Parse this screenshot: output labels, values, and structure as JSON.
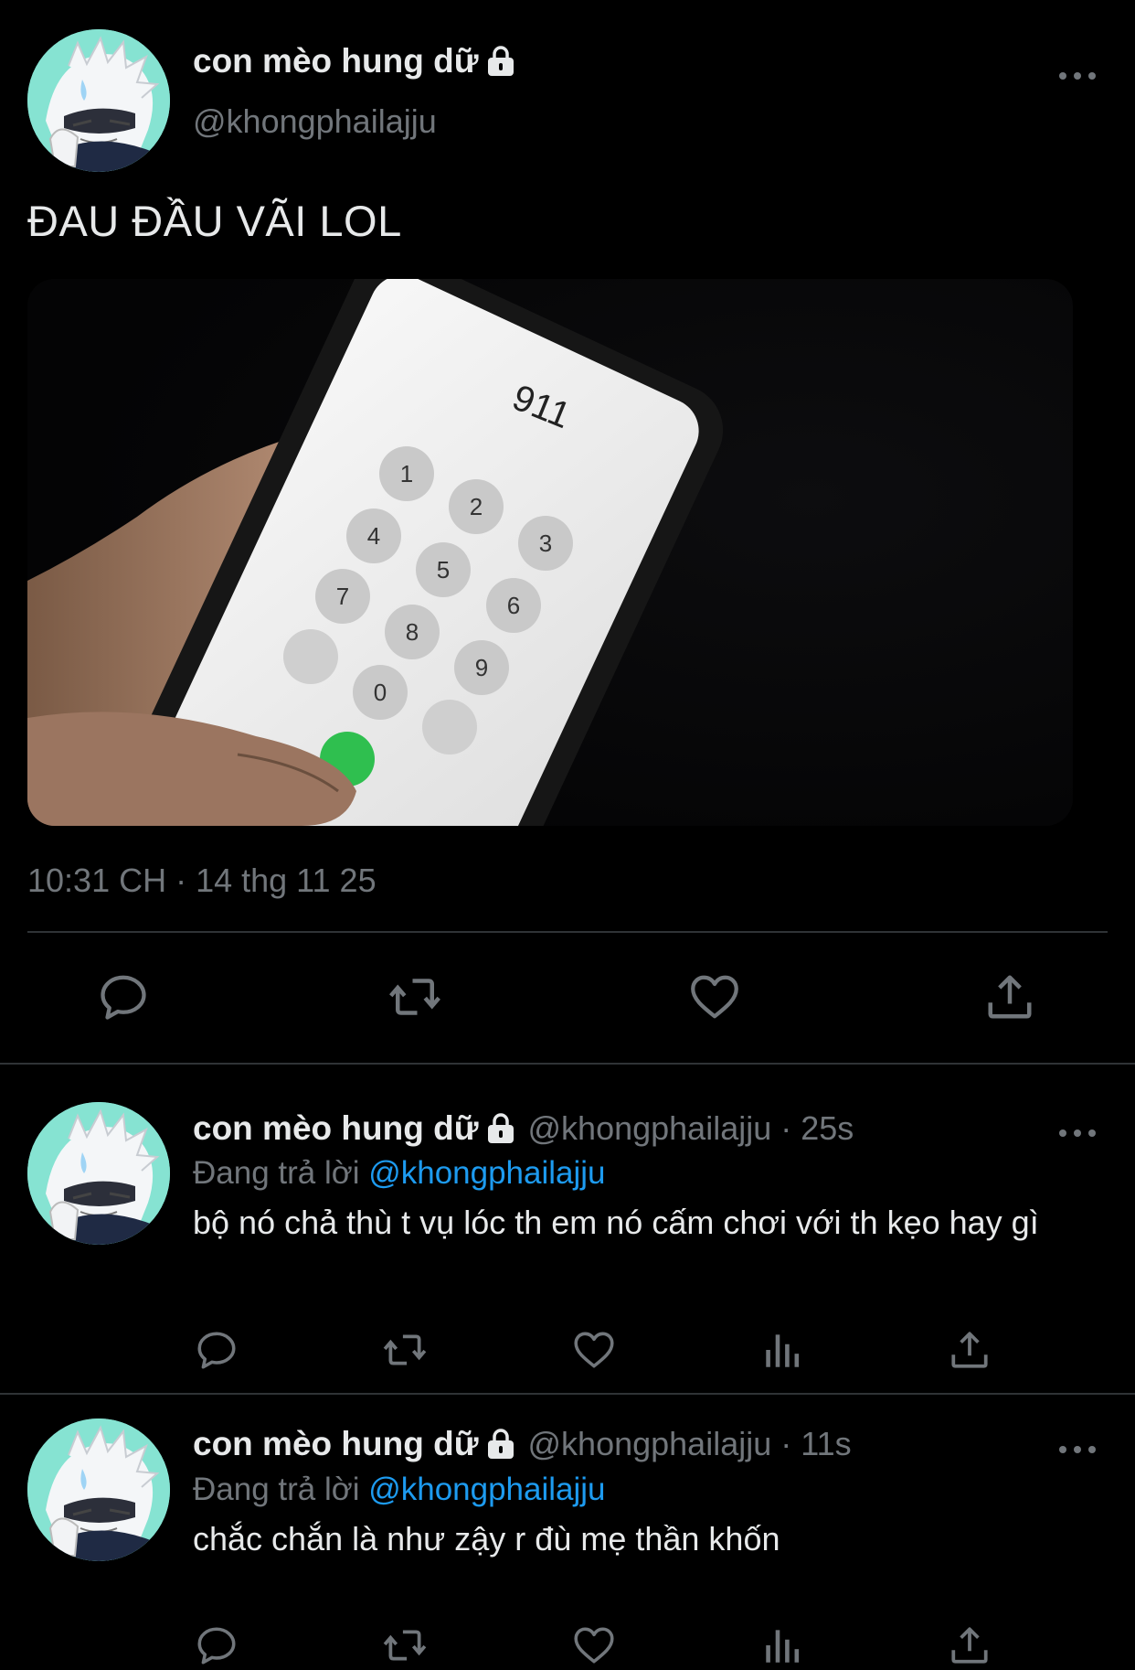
{
  "main_tweet": {
    "display_name": "con mèo hung dữ",
    "handle": "@khongphailajju",
    "text": "ĐAU ĐẦU VÃI LOL",
    "timestamp": "10:31 CH · 14 thg 11 25",
    "media": {
      "dialed_number": "911",
      "keypad": [
        "1",
        "2",
        "3",
        "4",
        "5",
        "6",
        "7",
        "8",
        "9",
        "0"
      ]
    }
  },
  "replies": [
    {
      "display_name": "con mèo hung dữ",
      "handle_time": "@khongphailajju · 25s",
      "replying_label": "Đang trả lời",
      "replying_to": "@khongphailajju",
      "text": "bộ nó chả thù t vụ lóc th em nó cấm chơi với th kẹo hay gì"
    },
    {
      "display_name": "con mèo hung dữ",
      "handle_time": "@khongphailajju · 11s",
      "replying_label": "Đang trả lời",
      "replying_to": "@khongphailajju",
      "text": "chắc chắn là như zậy r đù mẹ thần khốn"
    }
  ],
  "icons": {
    "reply": "speech-bubble-icon",
    "retweet": "retweet-icon",
    "like": "heart-icon",
    "views": "bar-chart-icon",
    "share": "share-icon",
    "more": "more-dots-icon",
    "lock": "lock-icon"
  },
  "colors": {
    "background": "#000000",
    "text": "#e7e9ea",
    "secondary": "#71767b",
    "mention": "#1d9bf0",
    "divider": "#2f3336"
  }
}
